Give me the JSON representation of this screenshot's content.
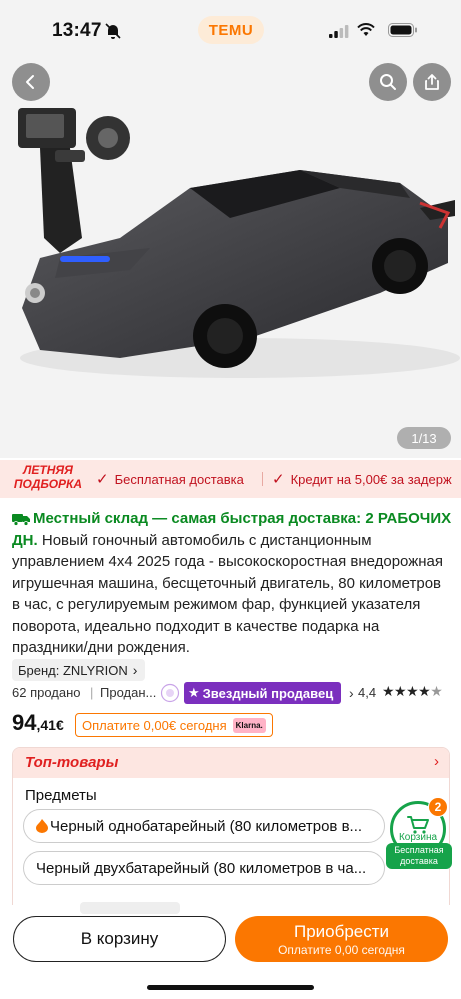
{
  "status_bar": {
    "time": "13:47"
  },
  "app": {
    "brand": "TEMU"
  },
  "gallery": {
    "counter": "1/13"
  },
  "promo": {
    "badge_line1": "ЛЕТНЯЯ",
    "badge_line2": "ПОДБОРКА",
    "item1": "Бесплатная доставка",
    "item2": "Кредит на 5,00€ за задерж"
  },
  "product": {
    "local_shipping": "Местный склад — самая быстрая доставка: 2 РАБОЧИХ ДН.",
    "title": "Новый гоночный автомобиль с дистанционным управлением 4x4 2025 года - высокоскоростная внедорожная игрушечная машина, бесщеточный двигатель, 80 километров в час, с регулируемым режимом фар, функцией указателя поворота, идеально подходит в качестве подарка на праздники/дни рождения.",
    "brand": "Бренд: ZNLYRION",
    "sold": "62 продано",
    "seller_short": "Продан...",
    "star_seller": "Звездный продавец",
    "rating": "4,4",
    "rating_value": 4.4,
    "price_whole": "94",
    "price_cents": ",41€",
    "pay_today": "Оплатите 0,00€ сегодня",
    "klarna": "Klarna."
  },
  "options_card": {
    "header": "Топ-товары",
    "items_label": "Предметы",
    "option1": "Черный однобатарейный (80 километров в...",
    "option2": "Черный двухбатарейный (80 километров в ча..."
  },
  "cart_badge": {
    "count": "2",
    "label": "Корзина",
    "free_line1": "Бесплатная",
    "free_line2": "доставка"
  },
  "bottom": {
    "add_to_cart": "В корзину",
    "buy": "Приобрести",
    "buy_sub": "Оплатите 0,00 сегодня"
  },
  "colors": {
    "accent": "#fb7701",
    "green": "#16a34a",
    "promo_red": "#e02020",
    "star_seller": "#7b2fbe"
  }
}
